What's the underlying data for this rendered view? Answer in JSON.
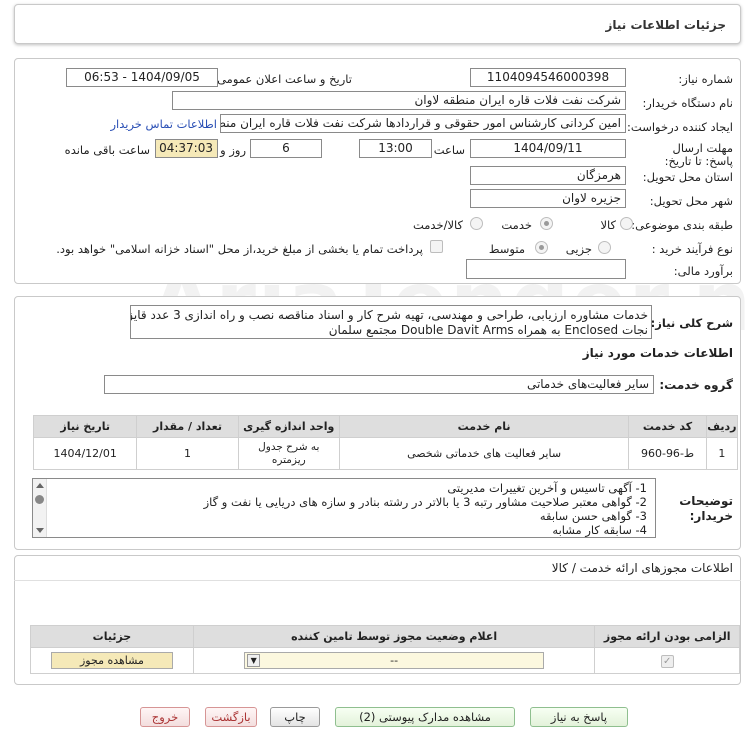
{
  "page_title": "جزئیات اطلاعات نیاز",
  "fields": {
    "need_number_label": "شماره نیاز:",
    "need_number": "1104094546000398",
    "announce_label": "تاریخ و ساعت اعلان عمومی:",
    "announce_value": "1404/09/05 - 06:53",
    "buyer_org_label": "نام دستگاه خریدار:",
    "buyer_org": "شرکت نفت فلات قاره ایران منطقه لاوان",
    "creator_label": "ایجاد کننده درخواست:",
    "creator": "امین کردانی کارشناس امور حقوقی و قراردادها شرکت نفت فلات قاره ایران منطقه لاوان",
    "contact_link": "اطلاعات تماس خریدار",
    "deadline_label": "مهلت ارسال پاسخ: تا تاریخ:",
    "deadline_date": "1404/09/11",
    "hour_label": "ساعت",
    "deadline_time": "13:00",
    "days_value": "6",
    "days_label": "روز و",
    "remaining_time": "04:37:03",
    "remaining_label": "ساعت باقی مانده",
    "province_label": "استان محل تحویل:",
    "province": "هرمزگان",
    "city_label": "شهر محل تحویل:",
    "city": "جزیره لاوان",
    "category_label": "طبقه بندی موضوعی:",
    "category_options": [
      "کالا",
      "خدمت",
      "کالا/خدمت"
    ],
    "process_label": "نوع فرآیند خرید :",
    "process_options": [
      "جزیی",
      "متوسط"
    ],
    "payment_note": "پرداخت تمام یا بخشی از مبلغ خرید،از محل \"اسناد خزانه اسلامی\" خواهد بود.",
    "budget_label": "برآورد مالی:"
  },
  "summary": {
    "label": "شرح کلی نیاز:",
    "line1": "خدمات مشاوره ارزیابی، طراحی و مهندسی، تهیه شرح کار و اسناد مناقصه نصب و راه اندازی 3 عدد قایق",
    "line2": "نجات   Enclosed به همراه Double Davit Arms مجتمع سلمان"
  },
  "services": {
    "section_title": "اطلاعات خدمات مورد نیاز",
    "group_label": "گروه خدمت:",
    "group_value": "سایر فعالیت‌های خدماتی",
    "columns": [
      "ردیف",
      "کد خدمت",
      "نام خدمت",
      "واحد اندازه گیری",
      "تعداد / مقدار",
      "تاریخ نیاز"
    ],
    "rows": [
      {
        "row": "1",
        "code": "ط-96-960",
        "name": "سایر فعالیت های خدماتی شخصی",
        "unit": "به شرح جدول ریزمتره",
        "qty": "1",
        "date": "1404/12/01"
      }
    ]
  },
  "buyer_notes": {
    "label": "توضیحات خریدار:",
    "lines": [
      "1-    آگهی تاسیس و آخرین تغییرات مدیریتی",
      "2-    گواهی معتبر صلاحیت مشاور رتبه 3 یا بالاتر در رشته بنادر  و سازه های دریایی یا نفت و گاز",
      "3-    گواهی حسن سابقه",
      "4-    سابقه کار مشابه"
    ]
  },
  "permits": {
    "section_title": "اطلاعات مجوزهای ارائه خدمت / کالا",
    "columns": [
      "الزامی بودن ارائه مجوز",
      "اعلام وضعیت مجوز توسط تامین کننده",
      "جزئیات"
    ],
    "select_value": "--",
    "view_button": "مشاهده مجوز"
  },
  "footer_buttons": {
    "reply": "پاسخ به نیاز",
    "attachments": "مشاهده مدارک پیوستی (2)",
    "print": "چاپ",
    "back": "بازگشت",
    "exit": "خروج"
  },
  "watermark": "AriaTender.neT"
}
